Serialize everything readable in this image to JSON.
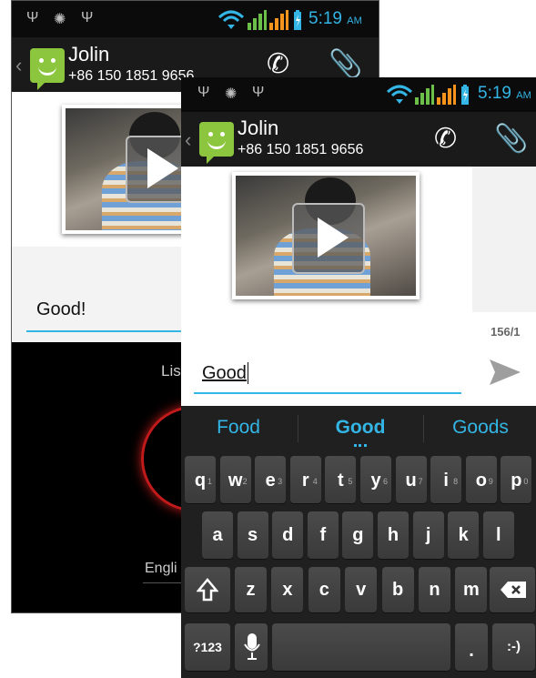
{
  "back_phone": {
    "status_icons": [
      "usb-icon",
      "android-debug-icon",
      "usb-icon"
    ],
    "time": "5:19",
    "time_suffix": "AM",
    "contact_name": "Jolin",
    "contact_number": "+86 150 1851 9656",
    "message_text": "Good!",
    "voice_prompt": "Lis",
    "language_label": "Engli"
  },
  "front_phone": {
    "status_icons": [
      "usb-icon",
      "android-debug-icon",
      "usb-icon"
    ],
    "time": "5:19",
    "time_suffix": "AM",
    "contact_name": "Jolin",
    "contact_number": "+86 150 1851 9656",
    "char_counter": "156/1",
    "message_text": "Good",
    "suggestions": [
      "Food",
      "Good",
      "Goods"
    ],
    "keyboard": {
      "row1": [
        {
          "k": "q",
          "h": "1"
        },
        {
          "k": "w",
          "h": "2"
        },
        {
          "k": "e",
          "h": "3"
        },
        {
          "k": "r",
          "h": "4"
        },
        {
          "k": "t",
          "h": "5"
        },
        {
          "k": "y",
          "h": "6"
        },
        {
          "k": "u",
          "h": "7"
        },
        {
          "k": "i",
          "h": "8"
        },
        {
          "k": "o",
          "h": "9"
        },
        {
          "k": "p",
          "h": "0"
        }
      ],
      "row2": [
        "a",
        "s",
        "d",
        "f",
        "g",
        "h",
        "j",
        "k",
        "l"
      ],
      "row3": [
        "z",
        "x",
        "c",
        "v",
        "b",
        "n",
        "m"
      ],
      "symbols_key": "?123",
      "period_key": ".",
      "smiley_key": ":-)"
    }
  },
  "colors": {
    "accent": "#33b5e5",
    "avatar_green": "#8cc63e",
    "record_ring": "#c01a1a",
    "signal_orange": "#f7941d",
    "signal_green": "#6cc04a"
  }
}
